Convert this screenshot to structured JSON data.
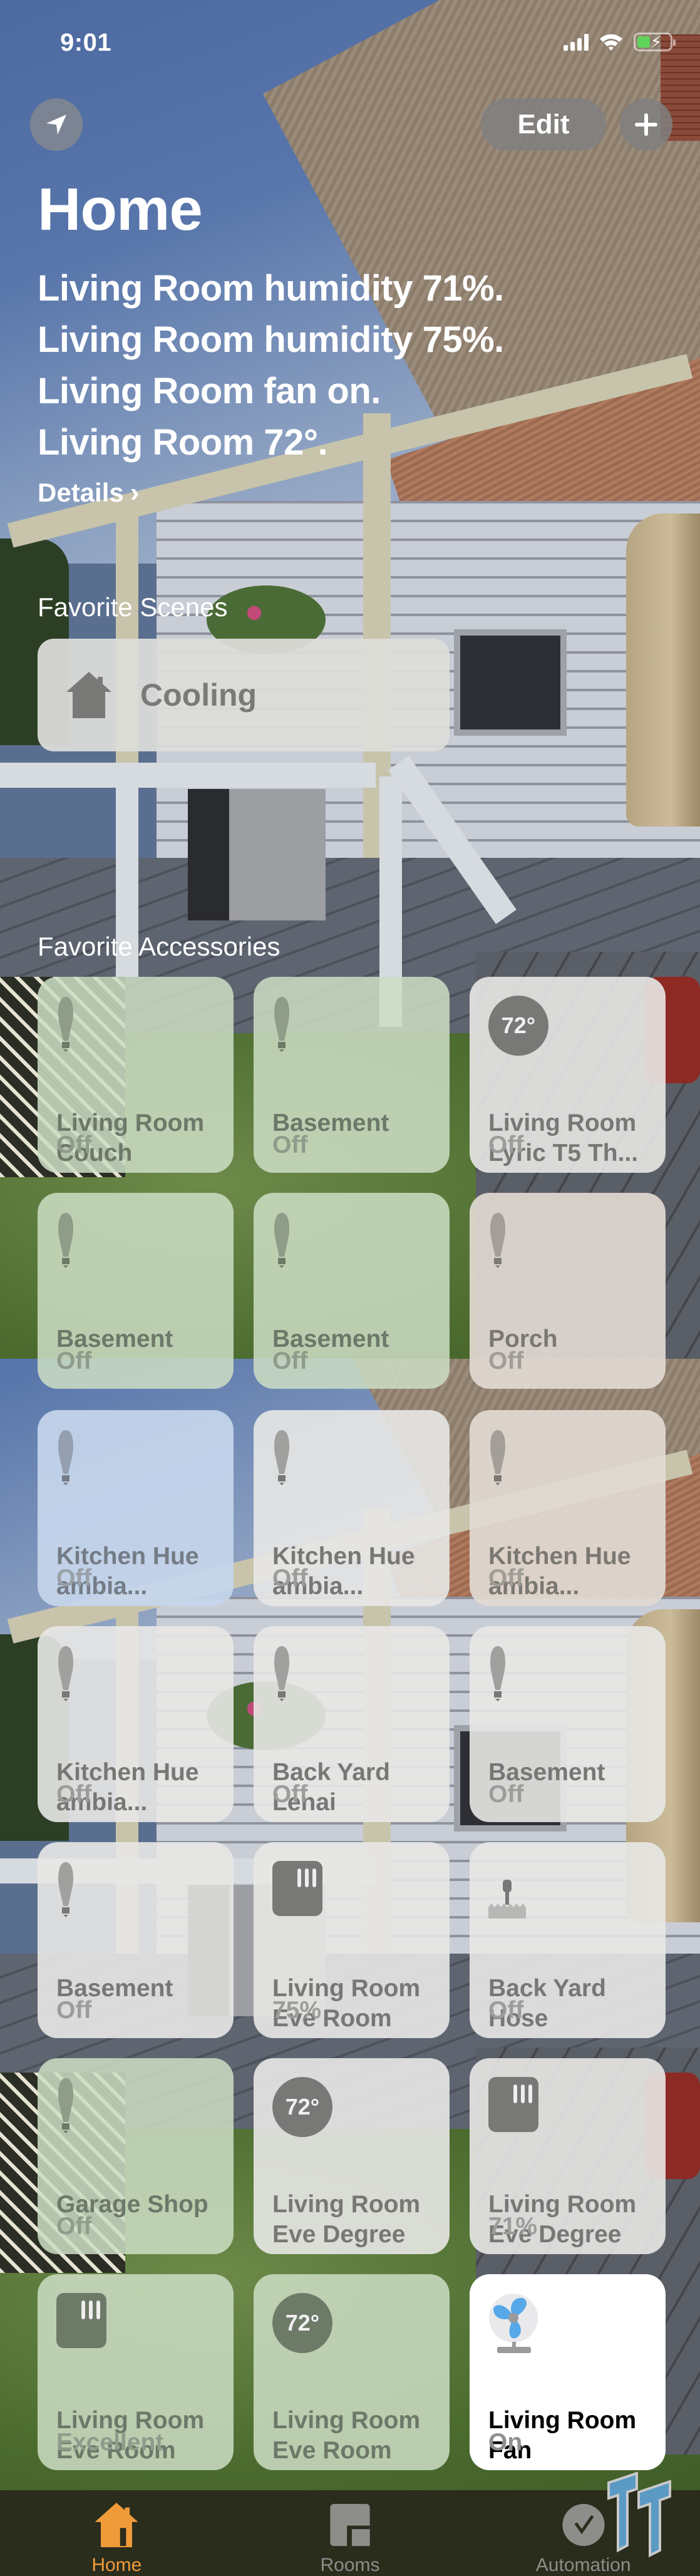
{
  "status_bar": {
    "time": "9:01",
    "signal_icon": "cellular-signal-icon",
    "wifi_icon": "wifi-icon",
    "battery_icon": "battery-charging-icon",
    "battery_color": "#5fd25a"
  },
  "header": {
    "location_icon": "location-arrow-icon",
    "edit_label": "Edit",
    "add_icon": "plus-icon",
    "title": "Home",
    "summary": [
      "Living Room humidity 71%.",
      "Living Room humidity 75%.",
      "Living Room fan on.",
      "Living Room 72°."
    ],
    "details_label": "Details",
    "details_chevron": "›"
  },
  "favorite_scenes": {
    "label": "Favorite Scenes",
    "items": [
      {
        "name": "Cooling",
        "icon": "house-icon"
      }
    ]
  },
  "favorite_accessories": {
    "label": "Favorite Accessories",
    "items": [
      {
        "name": "Living Room Couch",
        "state": "Off",
        "icon": "lightbulb-icon"
      },
      {
        "name": "Basement",
        "state": "Off",
        "icon": "lightbulb-icon"
      },
      {
        "name": "Living Room Lyric T5 Th...",
        "state": "Off",
        "icon": "thermostat-icon",
        "icon_text": "72°"
      },
      {
        "name": "Basement",
        "state": "Off",
        "icon": "lightbulb-icon"
      },
      {
        "name": "Basement",
        "state": "Off",
        "icon": "lightbulb-icon"
      },
      {
        "name": "Porch",
        "state": "Off",
        "icon": "lightbulb-icon"
      },
      {
        "name": "Kitchen Hue ambia...",
        "state": "Off",
        "icon": "lightbulb-icon"
      },
      {
        "name": "Kitchen Hue ambia...",
        "state": "Off",
        "icon": "lightbulb-icon"
      },
      {
        "name": "Kitchen Hue ambia...",
        "state": "Off",
        "icon": "lightbulb-icon"
      },
      {
        "name": "Kitchen Hue ambia...",
        "state": "Off",
        "icon": "lightbulb-icon"
      },
      {
        "name": "Back Yard Lenai",
        "state": "Off",
        "icon": "lightbulb-icon"
      },
      {
        "name": "Basement",
        "state": "Off",
        "icon": "lightbulb-icon"
      },
      {
        "name": "Basement",
        "state": "Off",
        "icon": "lightbulb-icon"
      },
      {
        "name": "Living Room Eve Room",
        "state": "75%",
        "icon": "humidity-sensor-icon"
      },
      {
        "name": "Back Yard Hose",
        "state": "Off",
        "icon": "sprinkler-icon"
      },
      {
        "name": "Garage Shop",
        "state": "Off",
        "icon": "lightbulb-icon"
      },
      {
        "name": "Living Room Eve Degree",
        "state": "",
        "icon": "thermostat-icon",
        "icon_text": "72°"
      },
      {
        "name": "Living Room Eve Degree",
        "state": "71%",
        "icon": "humidity-sensor-icon"
      },
      {
        "name": "Living Room Eve Room",
        "state": "Excellent",
        "icon": "air-quality-sensor-icon"
      },
      {
        "name": "Living Room Eve Room",
        "state": "",
        "icon": "thermostat-icon",
        "icon_text": "72°"
      },
      {
        "name": "Living Room Fan",
        "state": "On",
        "icon": "fan-icon",
        "active": true
      }
    ]
  },
  "tab_bar": {
    "tabs": [
      {
        "label": "Home",
        "icon": "home-tab-icon",
        "active": true
      },
      {
        "label": "Rooms",
        "icon": "rooms-tab-icon",
        "active": false
      },
      {
        "label": "Automation",
        "icon": "automation-tab-icon",
        "active": false
      }
    ],
    "active_color": "#f09b3a"
  }
}
